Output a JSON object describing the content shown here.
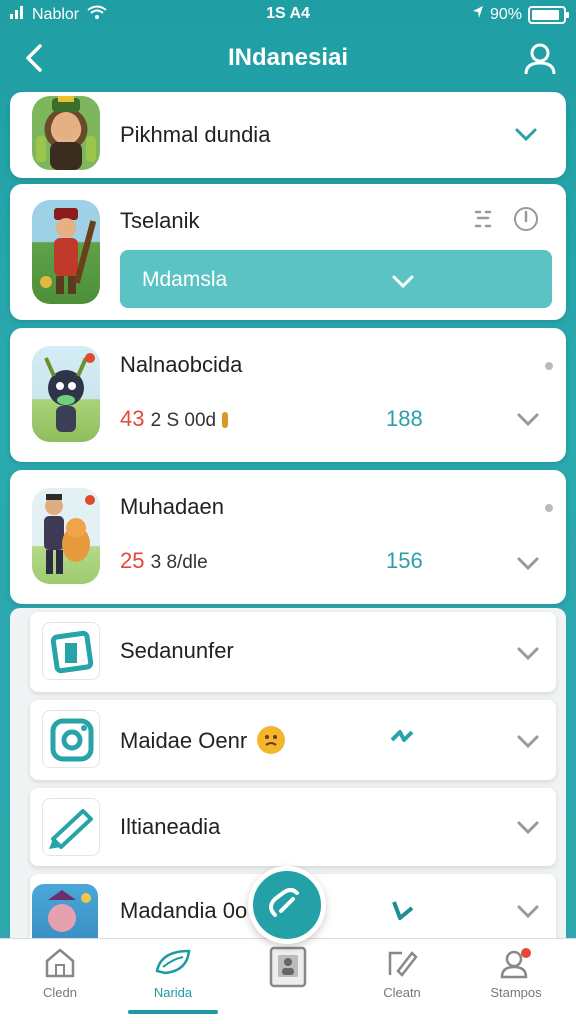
{
  "status": {
    "carrier": "Nablor",
    "time": "1S A4",
    "battery": "90%",
    "battery_level": 0.9
  },
  "header": {
    "title": "INdanesiai"
  },
  "cards": [
    {
      "title": "Pikhmal dundia"
    },
    {
      "title": "Tselanik",
      "button_label": "Mdamsla"
    },
    {
      "title": "Nalnaobcida",
      "stat_red": "43",
      "stat_rest": "2 S 00d",
      "stat_right": "188"
    },
    {
      "title": "Muhadaen",
      "stat_red": "25",
      "stat_rest": "3 8/dle",
      "stat_right": "156"
    }
  ],
  "list_items": [
    {
      "title": "Sedanunfer"
    },
    {
      "title": "Maidae Oenr"
    },
    {
      "title": "Iltianeadia"
    },
    {
      "title": "Madandia 0o"
    }
  ],
  "nav": [
    {
      "label": "Cledn"
    },
    {
      "label": "Narida"
    },
    {
      "label": ""
    },
    {
      "label": "Cleatn"
    },
    {
      "label": "Stampos"
    }
  ],
  "colors": {
    "teal": "#23a1a6",
    "accent_button": "#5cc3c4",
    "badge_red": "#e4473a"
  }
}
